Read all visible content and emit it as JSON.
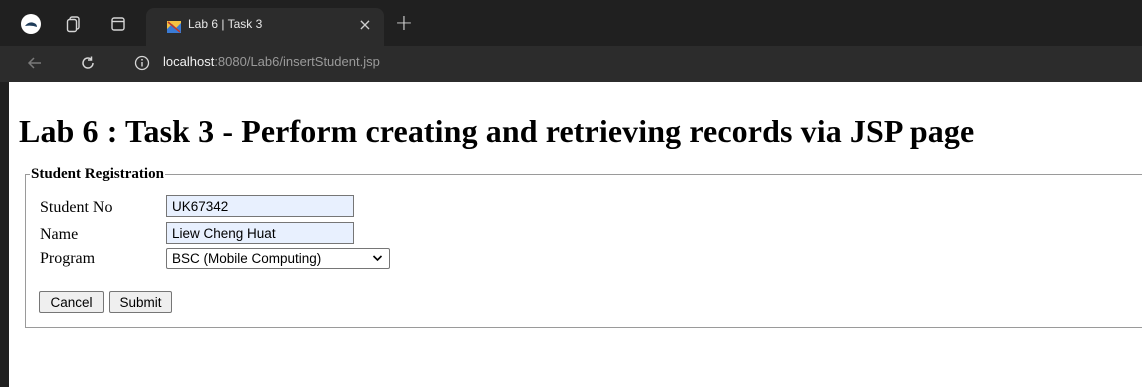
{
  "browser": {
    "tab": {
      "title": "Lab 6 | Task 3"
    },
    "address": {
      "host": "localhost",
      "rest": ":8080/Lab6/insertStudent.jsp"
    },
    "icons": [
      "profile-icon",
      "workspaces-icon",
      "tab-actions-icon",
      "favicon-icon",
      "close-icon",
      "new-tab-icon",
      "back-icon",
      "reload-icon",
      "info-icon"
    ]
  },
  "page": {
    "title": "Lab 6 : Task 3 - Perform creating and retrieving records via JSP page"
  },
  "form": {
    "legend": "Student Registration",
    "student_no": {
      "label": "Student No",
      "value": "UK67342"
    },
    "name": {
      "label": "Name",
      "value": "Liew Cheng Huat"
    },
    "program": {
      "label": "Program",
      "selected": "BSC (Mobile Computing)"
    },
    "buttons": {
      "cancel": "Cancel",
      "submit": "Submit"
    }
  }
}
